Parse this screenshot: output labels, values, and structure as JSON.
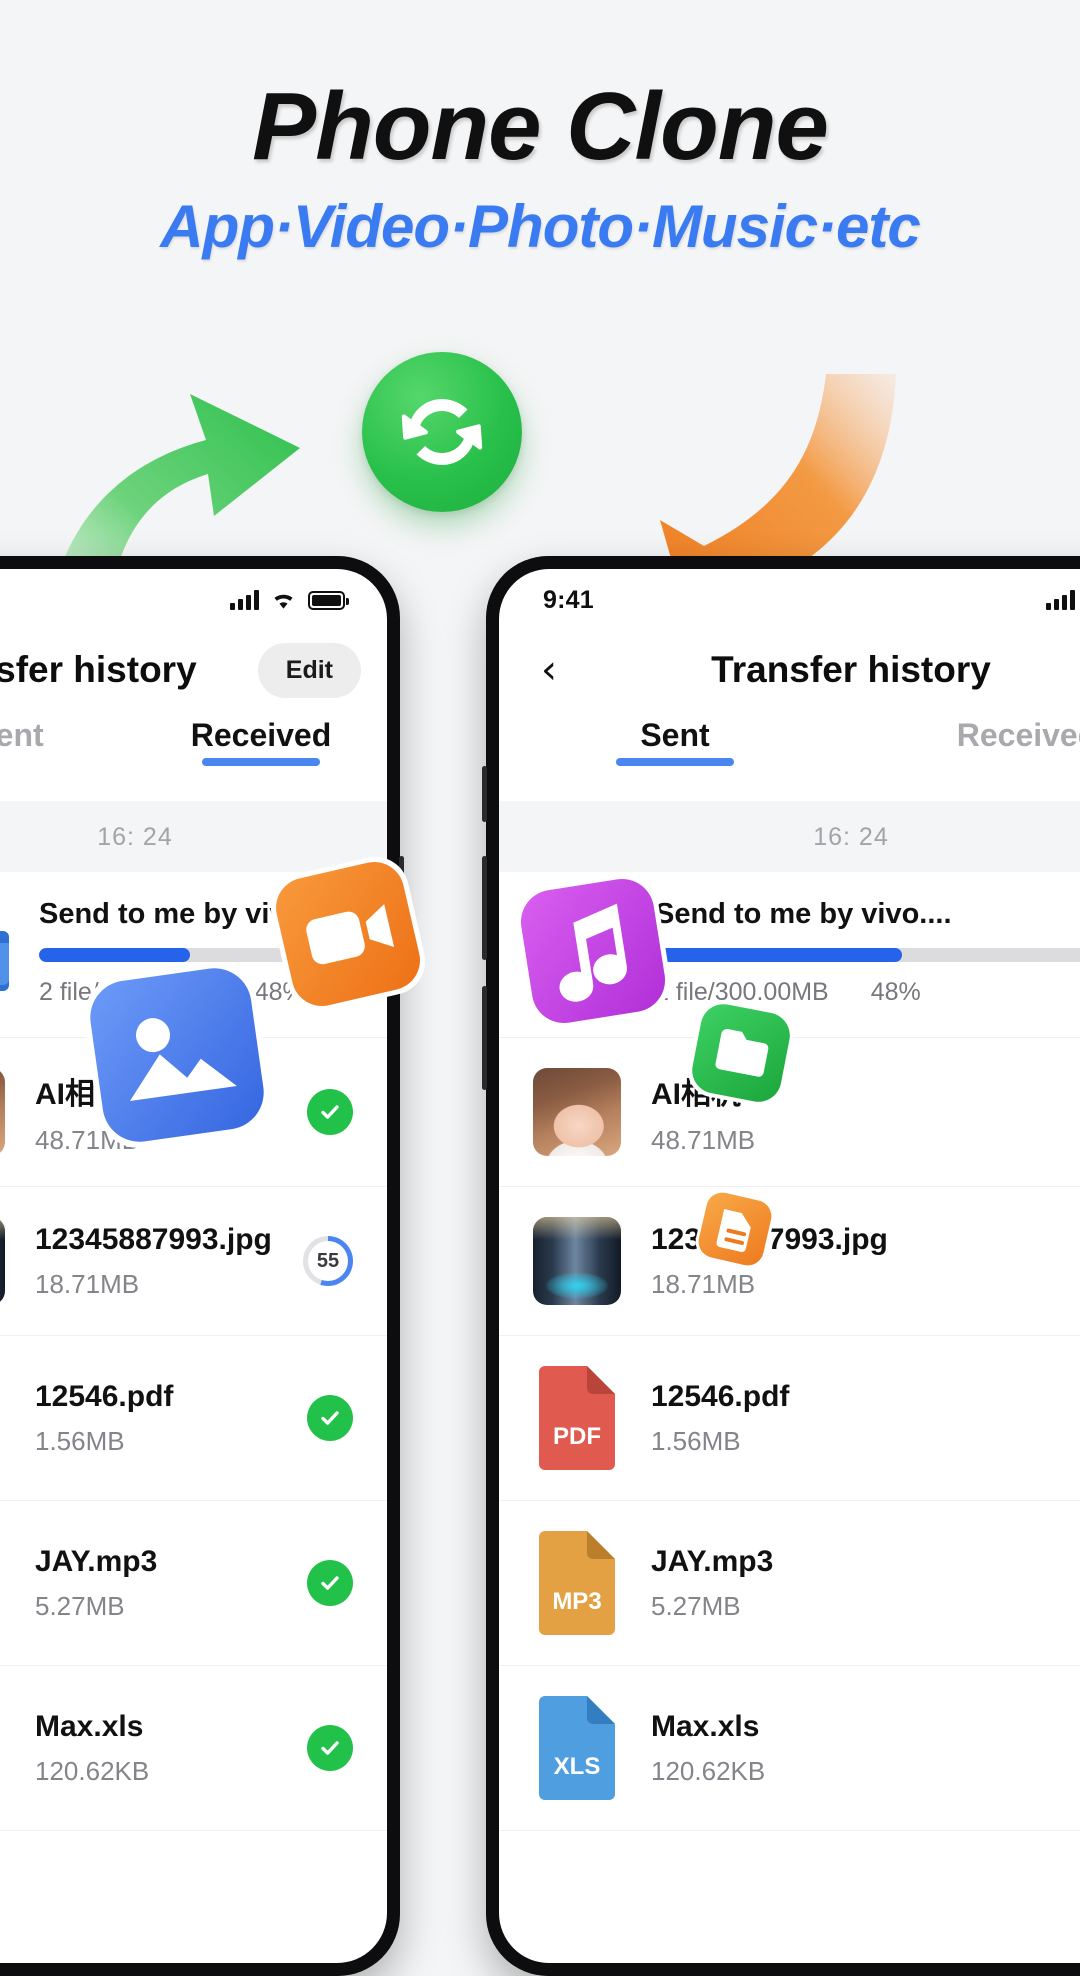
{
  "hero": {
    "title": "Phone Clone",
    "subtitle": "App·Video·Photo·Music·etc",
    "accent_blue": "#3a7bf2",
    "accent_green": "#28c04a",
    "accent_orange": "#f0812a",
    "sync_icon": "sync-refresh-icon",
    "arrow_up_icon": "curved-arrow-up-green-icon",
    "arrow_down_icon": "curved-arrow-down-orange-icon"
  },
  "phone_left": {
    "status_bar": {
      "time": "",
      "signal_icon": "cellular-bars-icon",
      "wifi_icon": "wifi-icon",
      "battery_icon": "battery-icon"
    },
    "nav": {
      "title": "Transfer history",
      "edit_label": "Edit"
    },
    "tabs": [
      {
        "label": "Sent",
        "active": false
      },
      {
        "label": "Received",
        "active": true
      }
    ],
    "timestamp": "16: 24",
    "transfer": {
      "name": "Send to me by vivo....",
      "files_size": "2 file/300.00MB",
      "percent_label": "48%",
      "percent_value": 48,
      "folder_icon": "folder-icon"
    },
    "files": [
      {
        "name": "AI相机",
        "size": "48.71MB",
        "thumb": "photo-girl-thumb",
        "status": "done",
        "status_icon": "check-circle-icon"
      },
      {
        "name": "12345887993.jpg",
        "size": "18.71MB",
        "thumb": "photo-street-thumb",
        "status": "progress",
        "status_icon": "progress-ring-icon",
        "progress_label": "55",
        "progress_value": 55
      },
      {
        "name": "12546.pdf",
        "size": "1.56MB",
        "thumb": "pdf-file-icon",
        "status": "done",
        "status_icon": "check-circle-icon"
      },
      {
        "name": "JAY.mp3",
        "size": "5.27MB",
        "thumb": "mp3-file-icon",
        "status": "done",
        "status_icon": "check-circle-icon"
      },
      {
        "name": "Max.xls",
        "size": "120.62KB",
        "thumb": "xls-file-icon",
        "status": "done",
        "status_icon": "check-circle-icon"
      }
    ]
  },
  "phone_right": {
    "status_bar": {
      "time": "9:41",
      "signal_icon": "cellular-bars-icon",
      "wifi_icon": "wifi-icon",
      "battery_icon": "battery-icon"
    },
    "nav": {
      "back_icon": "chevron-left-icon",
      "title": "Transfer history"
    },
    "tabs": [
      {
        "label": "Sent",
        "active": true
      },
      {
        "label": "Received",
        "active": false
      }
    ],
    "timestamp": "16: 24",
    "transfer": {
      "name": "Send to me by vivo....",
      "files_size": "2 file/300.00MB",
      "percent_label": "48%",
      "percent_value": 48,
      "folder_icon": "folder-icon"
    },
    "files": [
      {
        "name": "AI相机",
        "size": "48.71MB",
        "thumb": "photo-girl-thumb"
      },
      {
        "name": "12345887993.jpg",
        "size": "18.71MB",
        "thumb": "photo-street-thumb"
      },
      {
        "name": "12546.pdf",
        "size": "1.56MB",
        "thumb": "pdf-file-icon",
        "badge": "PDF"
      },
      {
        "name": "JAY.mp3",
        "size": "5.27MB",
        "thumb": "mp3-file-icon",
        "badge": "MP3"
      },
      {
        "name": "Max.xls",
        "size": "120.62KB",
        "thumb": "xls-file-icon",
        "badge": "XLS"
      }
    ]
  },
  "file_badges": {
    "pdf": "PDF",
    "mp3": "MP3",
    "xls": "XLS"
  },
  "stickers": [
    {
      "name": "video-sticker-icon",
      "color": "#f2852c"
    },
    {
      "name": "photo-sticker-icon",
      "color": "#4a7ef0"
    },
    {
      "name": "music-sticker-icon",
      "color": "#c24ae0"
    },
    {
      "name": "folder-sticker-icon",
      "color": "#22b84a"
    },
    {
      "name": "document-sticker-icon",
      "color": "#f2952c"
    }
  ]
}
